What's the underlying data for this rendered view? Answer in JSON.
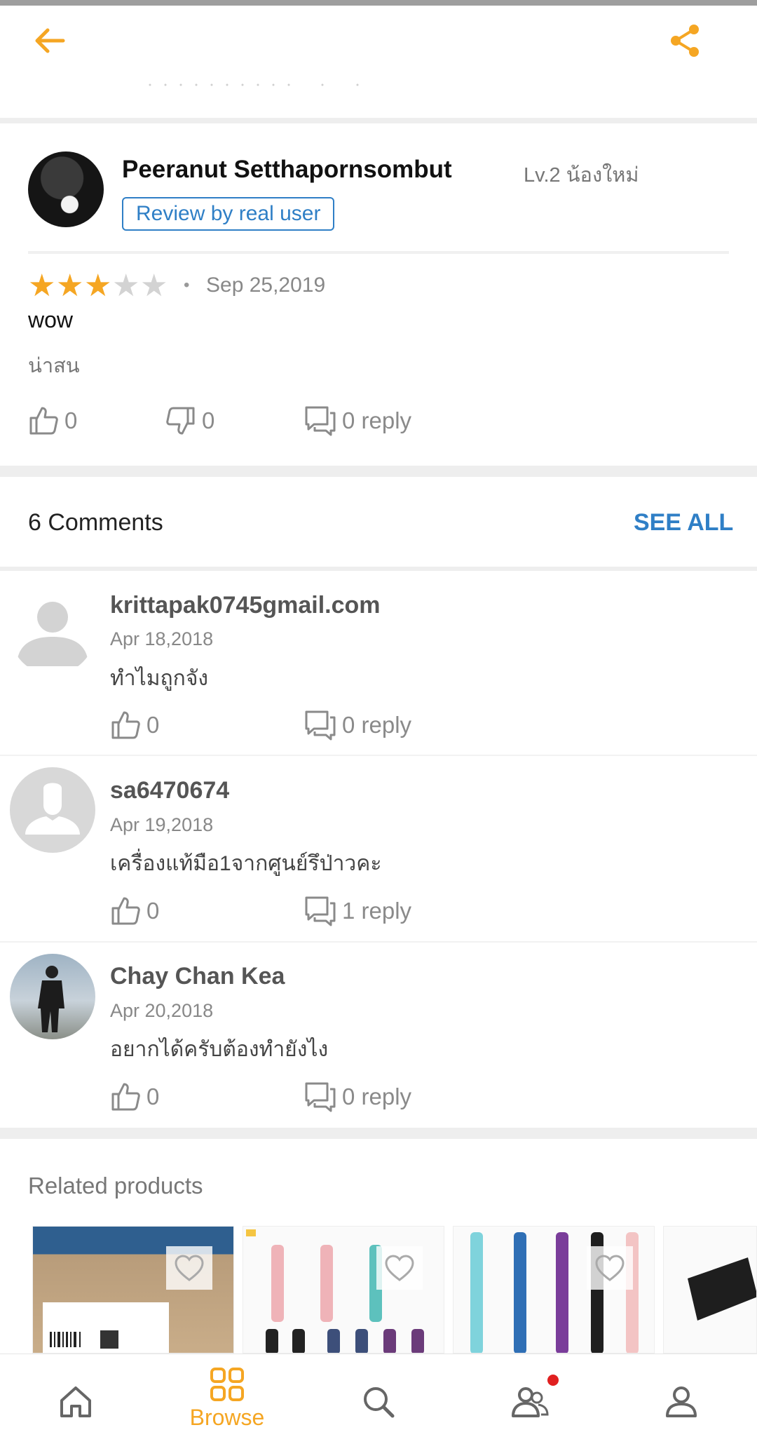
{
  "review": {
    "reviewer_name": "Peeranut Setthapornsombut",
    "level": "Lv.2 น้องใหม่",
    "badge": "Review by real user",
    "rating": 3,
    "rating_max": 5,
    "date": "Sep 25,2019",
    "title": "wow",
    "body": "น่าสน",
    "likes": "0",
    "dislikes": "0",
    "replies": "0 reply"
  },
  "comments_section": {
    "title": "6 Comments",
    "see_all": "SEE ALL",
    "items": [
      {
        "name": "krittapak0745gmail.com",
        "date": "Apr 18,2018",
        "text": "ทำไมถูกจัง",
        "likes": "0",
        "replies": "0 reply"
      },
      {
        "name": "sa6470674",
        "date": "Apr 19,2018",
        "text": "เครื่องแท้มือ1จากศูนย์รึป่าวคะ",
        "likes": "0",
        "replies": "1 reply"
      },
      {
        "name": "Chay Chan Kea",
        "date": "Apr 20,2018",
        "text": "อยากได้ครับต้องทำยังไง",
        "likes": "0",
        "replies": "0 reply"
      }
    ]
  },
  "related": {
    "title": "Related products"
  },
  "bottom_nav": {
    "browse_label": "Browse"
  },
  "colors": {
    "accent": "#f5a623",
    "link": "#2f7fc6",
    "notification": "#e02020"
  },
  "icons": [
    "back-arrow-icon",
    "share-icon",
    "thumbs-up-icon",
    "thumbs-down-icon",
    "comment-icon",
    "heart-icon",
    "home-icon",
    "browse-grid-icon",
    "search-icon",
    "community-icon",
    "profile-icon"
  ]
}
